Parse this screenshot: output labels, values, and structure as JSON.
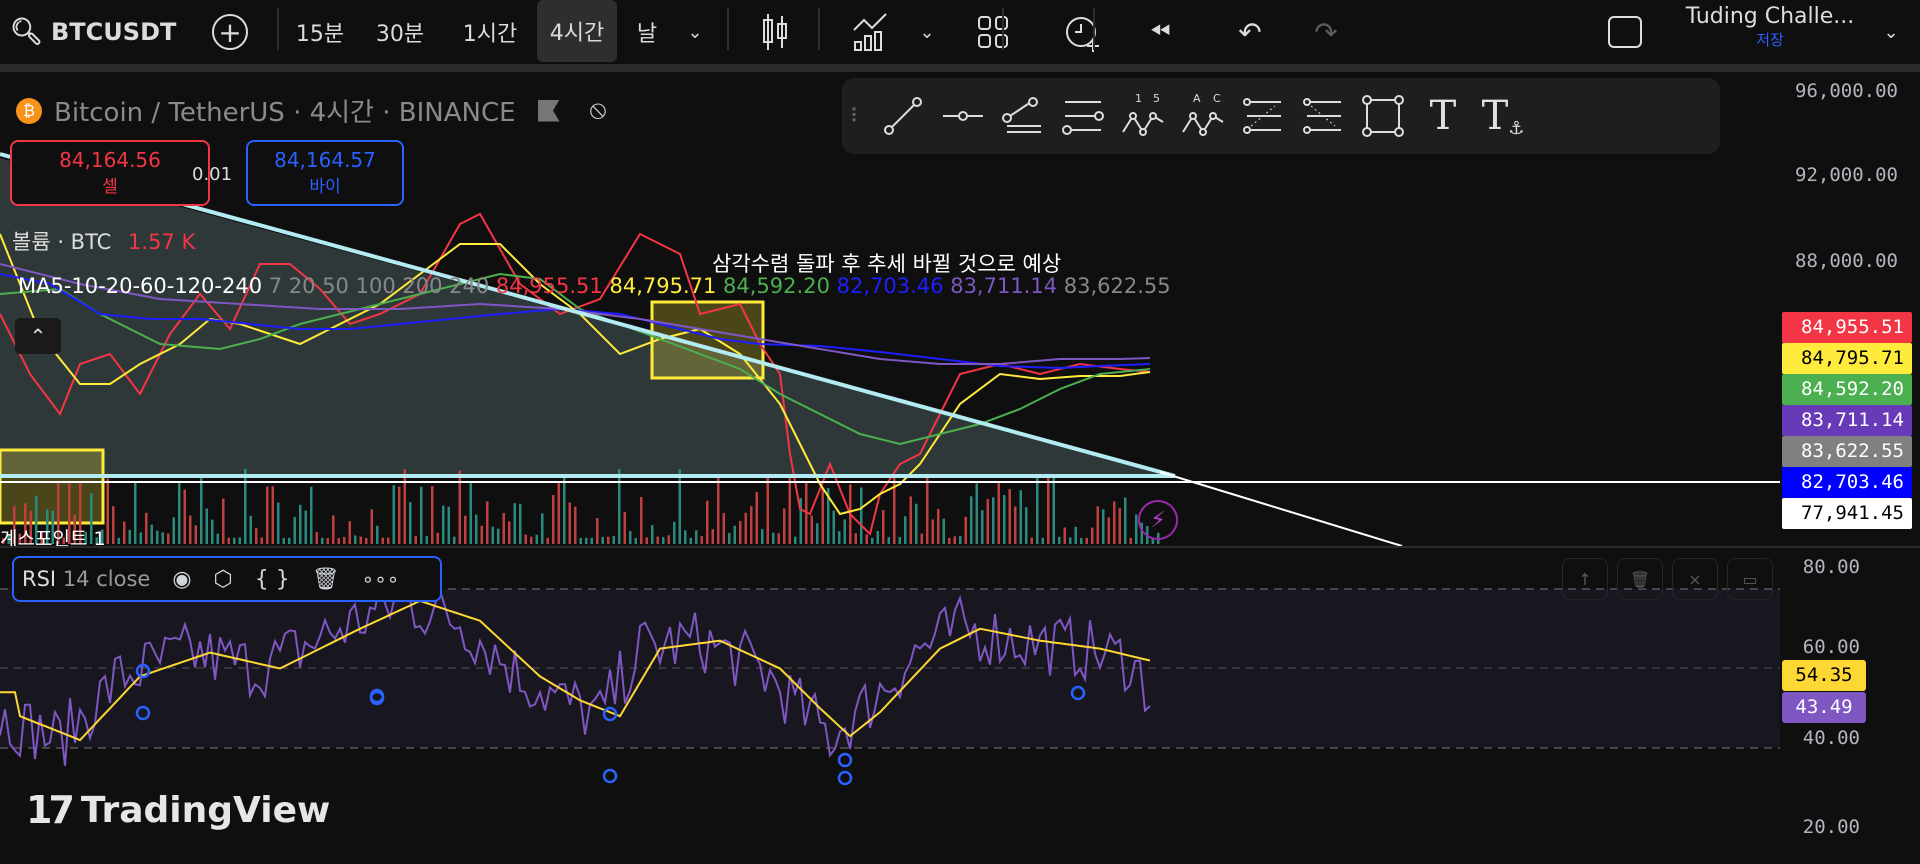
{
  "toolbar": {
    "symbol": "BTCUSDT",
    "intervals": [
      "15분",
      "30분",
      "1시간",
      "4시간",
      "날"
    ],
    "active_interval": "4시간",
    "layout_name": "Tuding Challe...",
    "save_label": "저장"
  },
  "header": {
    "title": "Bitcoin / TetherUS · 4시간 · BINANCE",
    "sell_price": "84,164.56",
    "sell_label": "셀",
    "spread": "0.01",
    "buy_price": "84,164.57",
    "buy_label": "바이"
  },
  "volume": {
    "label": "볼륨 · BTC",
    "value": "1.57 K"
  },
  "ma_legend": {
    "label": "MA5-10-20-60-120-240",
    "params": "7 20 50 100 200 240",
    "values": [
      "84,955.51",
      "84,795.71",
      "84,592.20",
      "82,703.46",
      "83,711.14",
      "83,622.55"
    ]
  },
  "annotation": "삼각수렴 돌파 후 추세 바뀔 것으로 예상",
  "bottom_label": "계스포인트 1",
  "price_axis": [
    "96,000.00",
    "92,000.00",
    "88,000.00"
  ],
  "price_tags": [
    {
      "value": "84,955.51",
      "bg": "#f23645",
      "fg": "#ffffff"
    },
    {
      "value": "84,795.71",
      "bg": "#ffeb3b",
      "fg": "#000000"
    },
    {
      "value": "84,592.20",
      "bg": "#4caf50",
      "fg": "#ffffff"
    },
    {
      "value": "83,711.14",
      "bg": "#673ab7",
      "fg": "#ffffff"
    },
    {
      "value": "83,622.55",
      "bg": "#808080",
      "fg": "#ffffff"
    },
    {
      "value": "82,703.46",
      "bg": "#0000ff",
      "fg": "#ffffff"
    },
    {
      "value": "77,941.45",
      "bg": "#ffffff",
      "fg": "#000000"
    }
  ],
  "rsi": {
    "label": "RSI",
    "params": "14 close",
    "axis": [
      "80.00",
      "60.00",
      "40.00",
      "20.00"
    ],
    "rsi_value": "43.49",
    "ma_value": "54.35"
  },
  "watermark": "TradingView",
  "colors": {
    "ma5": "#f23645",
    "ma10": "#ffeb3b",
    "ma20": "#4caf50",
    "ma60": "#0000ff",
    "ma120": "#673ab7",
    "rsi": "#7e57c2",
    "rsi_ma": "#fdd835"
  }
}
